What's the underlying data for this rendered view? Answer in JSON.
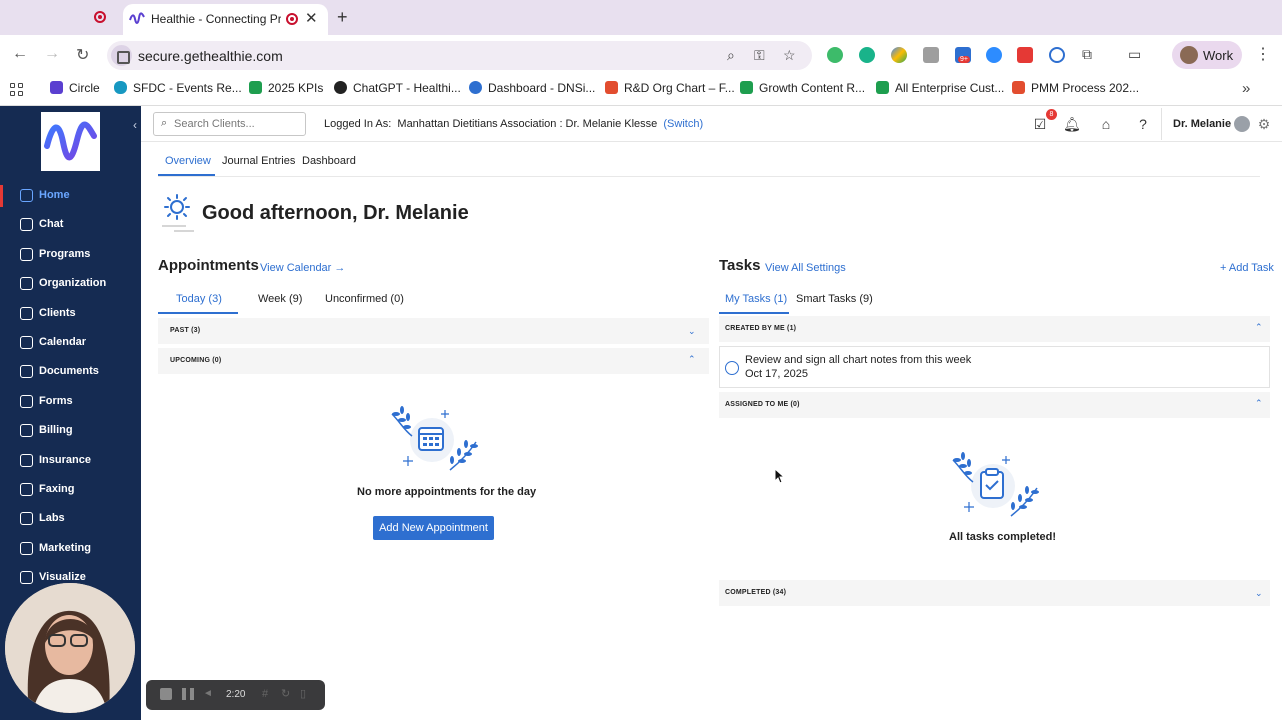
{
  "browser": {
    "tabs": [
      {
        "title": "",
        "recording": true
      },
      {
        "title": "Healthie - Connecting Pro",
        "recording": true,
        "active": true
      }
    ],
    "address": "secure.gethealthie.com",
    "profile_label": "Work",
    "extension_badge": "9+",
    "bookmarks": [
      {
        "label": "Circle",
        "icon": "circle-logo-icon",
        "color": "#5a3fd0"
      },
      {
        "label": "SFDC - Events Re...",
        "icon": "salesforce-cloud-icon",
        "color": "#1798c1"
      },
      {
        "label": "2025 KPIs",
        "icon": "sheets-icon",
        "color": "#1e9e4f"
      },
      {
        "label": "ChatGPT - Healthi...",
        "icon": "chatgpt-icon",
        "color": "#222222"
      },
      {
        "label": "Dashboard - DNSi...",
        "icon": "d-logo-icon",
        "color": "#2e6fd0"
      },
      {
        "label": "R&D Org Chart – F...",
        "icon": "figma-icon",
        "color": "#e24d2f"
      },
      {
        "label": "Growth Content R...",
        "icon": "sheets-icon",
        "color": "#1e9e4f"
      },
      {
        "label": "All Enterprise Cust...",
        "icon": "sheets-icon",
        "color": "#1e9e4f"
      },
      {
        "label": "PMM Process 202...",
        "icon": "figma-icon",
        "color": "#e24d2f"
      }
    ]
  },
  "sidebar": {
    "items": [
      {
        "label": "Home",
        "icon": "home-icon",
        "active": true
      },
      {
        "label": "Chat",
        "icon": "chat-icon"
      },
      {
        "label": "Programs",
        "icon": "programs-icon"
      },
      {
        "label": "Organization",
        "icon": "organization-icon"
      },
      {
        "label": "Clients",
        "icon": "clients-icon"
      },
      {
        "label": "Calendar",
        "icon": "calendar-icon"
      },
      {
        "label": "Documents",
        "icon": "documents-icon"
      },
      {
        "label": "Forms",
        "icon": "forms-icon"
      },
      {
        "label": "Billing",
        "icon": "billing-icon"
      },
      {
        "label": "Insurance",
        "icon": "insurance-icon"
      },
      {
        "label": "Faxing",
        "icon": "fax-icon"
      },
      {
        "label": "Labs",
        "icon": "labs-icon"
      },
      {
        "label": "Marketing",
        "icon": "marketing-icon"
      },
      {
        "label": "Visualize",
        "icon": "visualize-icon"
      }
    ]
  },
  "header": {
    "search_placeholder": "Search Clients...",
    "logged_in_prefix": "Logged In As:",
    "logged_in_org": "Manhattan Dietitians Association : Dr. Melanie Klesse",
    "switch_label": "(Switch)",
    "notification_count": "8",
    "user_name": "Dr. Melanie"
  },
  "page_tabs": [
    {
      "label": "Overview",
      "active": true
    },
    {
      "label": "Journal Entries"
    },
    {
      "label": "Dashboard"
    }
  ],
  "greeting": "Good afternoon, Dr. Melanie",
  "appointments": {
    "title": "Appointments",
    "view_calendar": "View Calendar →",
    "tabs": [
      {
        "label": "Today (3)",
        "active": true
      },
      {
        "label": "Week (9)"
      },
      {
        "label": "Unconfirmed (0)"
      }
    ],
    "groups": [
      {
        "label": "PAST (3)",
        "expanded": false
      },
      {
        "label": "UPCOMING (0)",
        "expanded": true
      }
    ],
    "empty_text": "No more appointments for the day",
    "add_button": "Add New Appointment"
  },
  "tasks": {
    "title": "Tasks",
    "view_all": "View All",
    "settings": "Settings",
    "add_task": "+ Add Task",
    "tabs": [
      {
        "label": "My Tasks (1)",
        "active": true
      },
      {
        "label": "Smart Tasks (9)"
      }
    ],
    "created_by_me": "CREATED BY ME (1)",
    "items": [
      {
        "text": "Review and sign all chart notes from this week",
        "date": "Oct 17, 2025",
        "done": false
      }
    ],
    "assigned_to_me": "ASSIGNED TO ME (0)",
    "empty_text": "All tasks completed!",
    "completed": "COMPLETED (34)"
  },
  "recorder": {
    "time": "2:20"
  },
  "colors": {
    "sidebar_bg": "#152b52",
    "accent": "#2e6fd0",
    "alert": "#e53935",
    "chrome_bg": "#e8e0ef"
  }
}
